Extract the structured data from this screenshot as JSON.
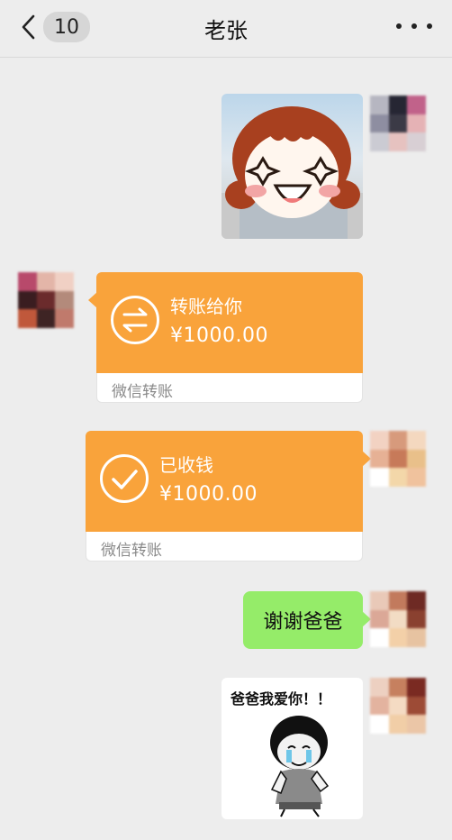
{
  "header": {
    "back_badge": "10",
    "title": "老张",
    "more_icon": "more-dots-icon"
  },
  "messages": [
    {
      "type": "sticker",
      "side": "right",
      "sticker": "cartoon-girl-sticker"
    },
    {
      "type": "transfer",
      "side": "left",
      "label": "转账给你",
      "amount": "¥1000.00",
      "footer": "微信转账",
      "icon": "transfer-arrows-icon",
      "color": "#f9a33b"
    },
    {
      "type": "transfer",
      "side": "right",
      "label": "已收钱",
      "amount": "¥1000.00",
      "footer": "微信转账",
      "icon": "checkmark-icon",
      "color": "#f9a33b"
    },
    {
      "type": "text",
      "side": "right",
      "text": "谢谢爸爸",
      "color": "#95ec69"
    },
    {
      "type": "sticker",
      "side": "right",
      "caption": "爸爸我爱你！！",
      "sticker": "meme-sticker"
    }
  ]
}
